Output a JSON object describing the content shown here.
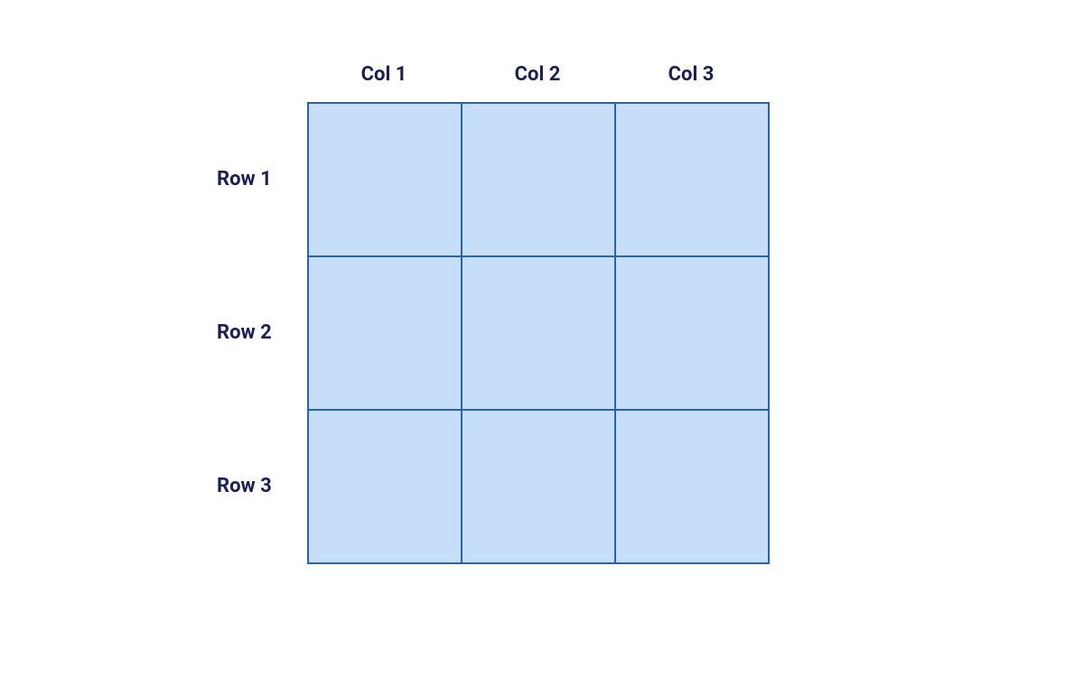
{
  "columns": [
    "Col 1",
    "Col 2",
    "Col 3"
  ],
  "rows": [
    "Row 1",
    "Row 2",
    "Row 3"
  ],
  "colors": {
    "label_text": "#1a2053",
    "cell_fill": "#c7defb",
    "cell_border": "#2b63a6"
  }
}
